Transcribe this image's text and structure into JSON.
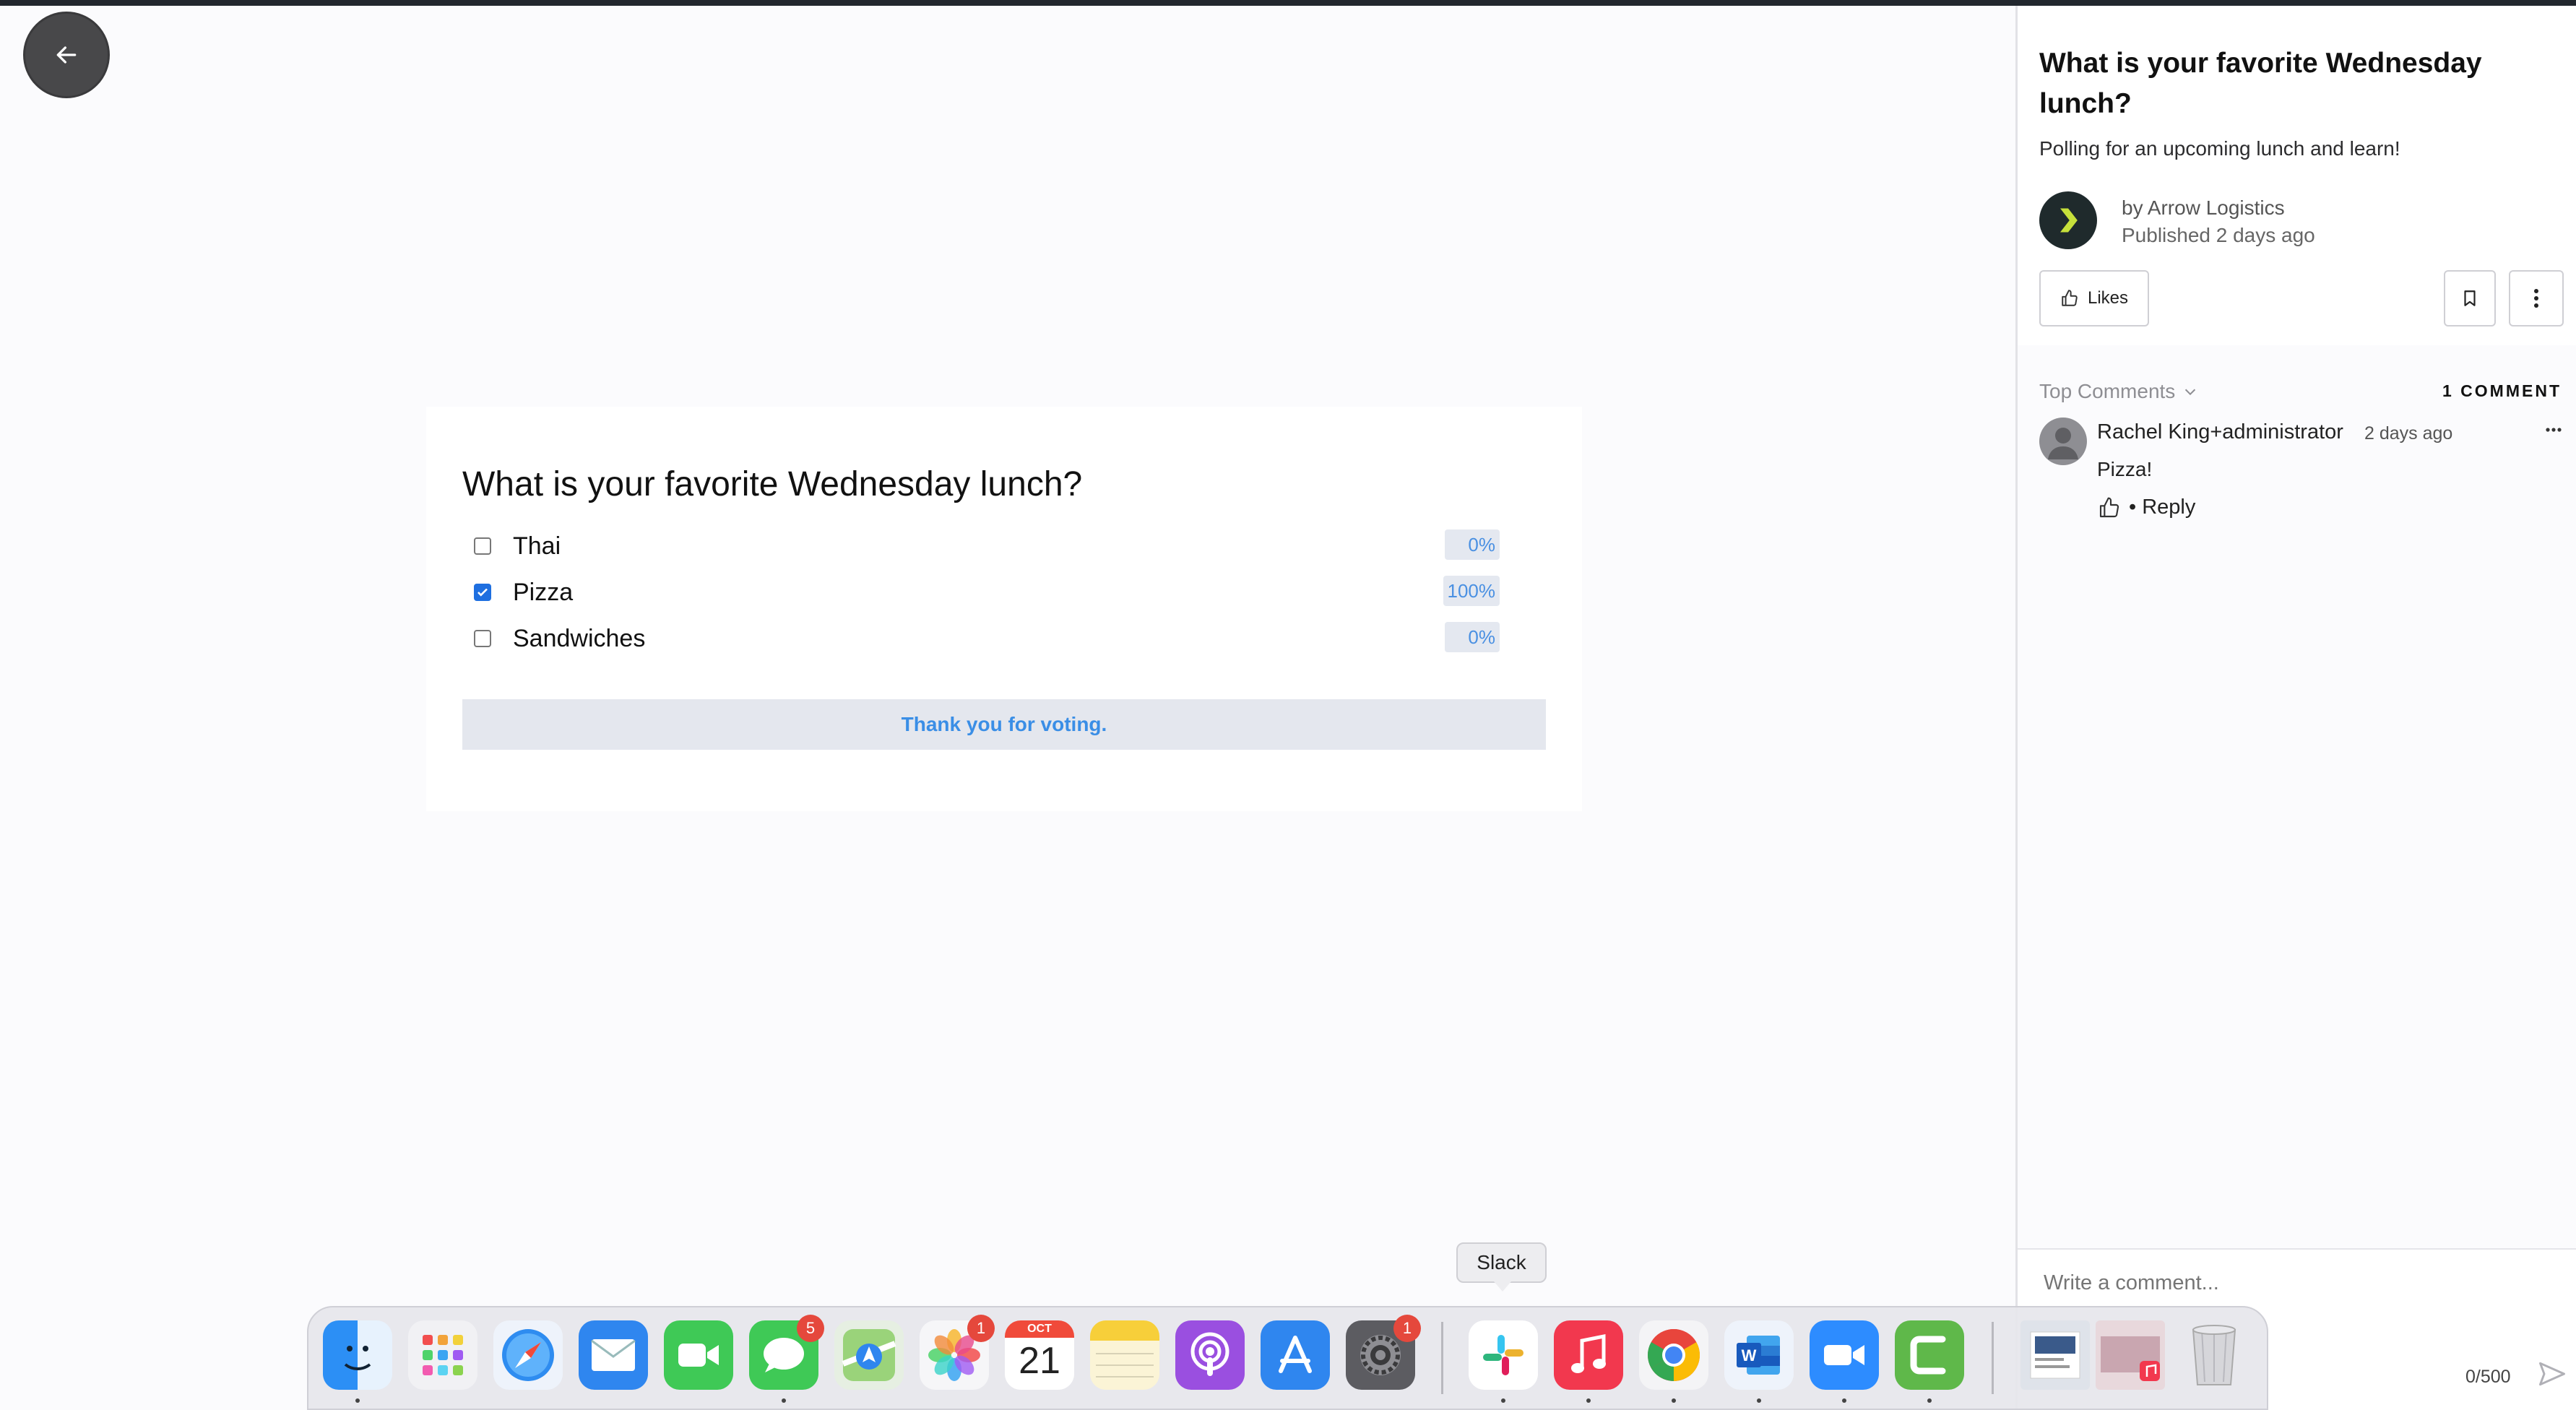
{
  "window": {
    "back_label": "Back"
  },
  "poll": {
    "title": "What is your favorite Wednesday lunch?",
    "options": [
      {
        "label": "Thai",
        "percent": "0%",
        "checked": false
      },
      {
        "label": "Pizza",
        "percent": "100%",
        "checked": true
      },
      {
        "label": "Sandwiches",
        "percent": "0%",
        "checked": false
      }
    ],
    "message": "Thank you for voting."
  },
  "sidebar": {
    "title": "What is your favorite Wednesday lunch?",
    "subtitle": "Polling for an upcoming lunch and learn!",
    "author_prefix": "by Arrow Logistics",
    "published": "Published 2 days ago",
    "likes_label": "Likes",
    "comments_sort": "Top Comments",
    "comment_count": "1 COMMENT",
    "comments": [
      {
        "author": "Rachel King+administrator",
        "time": "2 days ago",
        "text": "Pizza!",
        "reply_label": "• Reply"
      }
    ],
    "comment_placeholder": "Write a comment...",
    "char_counter": "0/500"
  },
  "dock": {
    "tooltip": "Slack",
    "calendar_month": "OCT",
    "calendar_day": "21",
    "items": [
      {
        "name": "Finder",
        "icon": "finder-icon",
        "badge": ""
      },
      {
        "name": "Launchpad",
        "icon": "launchpad-icon",
        "badge": ""
      },
      {
        "name": "Safari",
        "icon": "safari-icon",
        "badge": ""
      },
      {
        "name": "Mail",
        "icon": "mail-icon",
        "badge": ""
      },
      {
        "name": "FaceTime",
        "icon": "facetime-icon",
        "badge": ""
      },
      {
        "name": "Messages",
        "icon": "messages-icon",
        "badge": "5"
      },
      {
        "name": "Maps",
        "icon": "maps-icon",
        "badge": ""
      },
      {
        "name": "Photos",
        "icon": "photos-icon",
        "badge": "1"
      },
      {
        "name": "Calendar",
        "icon": "calendar-icon",
        "badge": ""
      },
      {
        "name": "Notes",
        "icon": "notes-icon",
        "badge": ""
      },
      {
        "name": "Podcasts",
        "icon": "podcasts-icon",
        "badge": ""
      },
      {
        "name": "App Store",
        "icon": "app-store-icon",
        "badge": ""
      },
      {
        "name": "System Settings",
        "icon": "settings-icon",
        "badge": "1"
      },
      {
        "name": "Slack",
        "icon": "slack-icon",
        "badge": ""
      },
      {
        "name": "Music",
        "icon": "music-icon",
        "badge": ""
      },
      {
        "name": "Chrome",
        "icon": "chrome-icon",
        "badge": ""
      },
      {
        "name": "Word",
        "icon": "word-icon",
        "badge": ""
      },
      {
        "name": "Zoom",
        "icon": "zoom-icon",
        "badge": ""
      },
      {
        "name": "Camtasia",
        "icon": "camtasia-icon",
        "badge": ""
      },
      {
        "name": "Downloads",
        "icon": "downloads-stack-icon",
        "badge": ""
      },
      {
        "name": "Recent",
        "icon": "recent-stack-icon",
        "badge": ""
      },
      {
        "name": "Trash",
        "icon": "trash-icon",
        "badge": ""
      }
    ]
  },
  "colors": {
    "accent_blue": "#3a8ee6",
    "checkbox_blue": "#1e6fe0",
    "badge_red": "#e5483c",
    "author_logo_green": "#c6e03b"
  }
}
